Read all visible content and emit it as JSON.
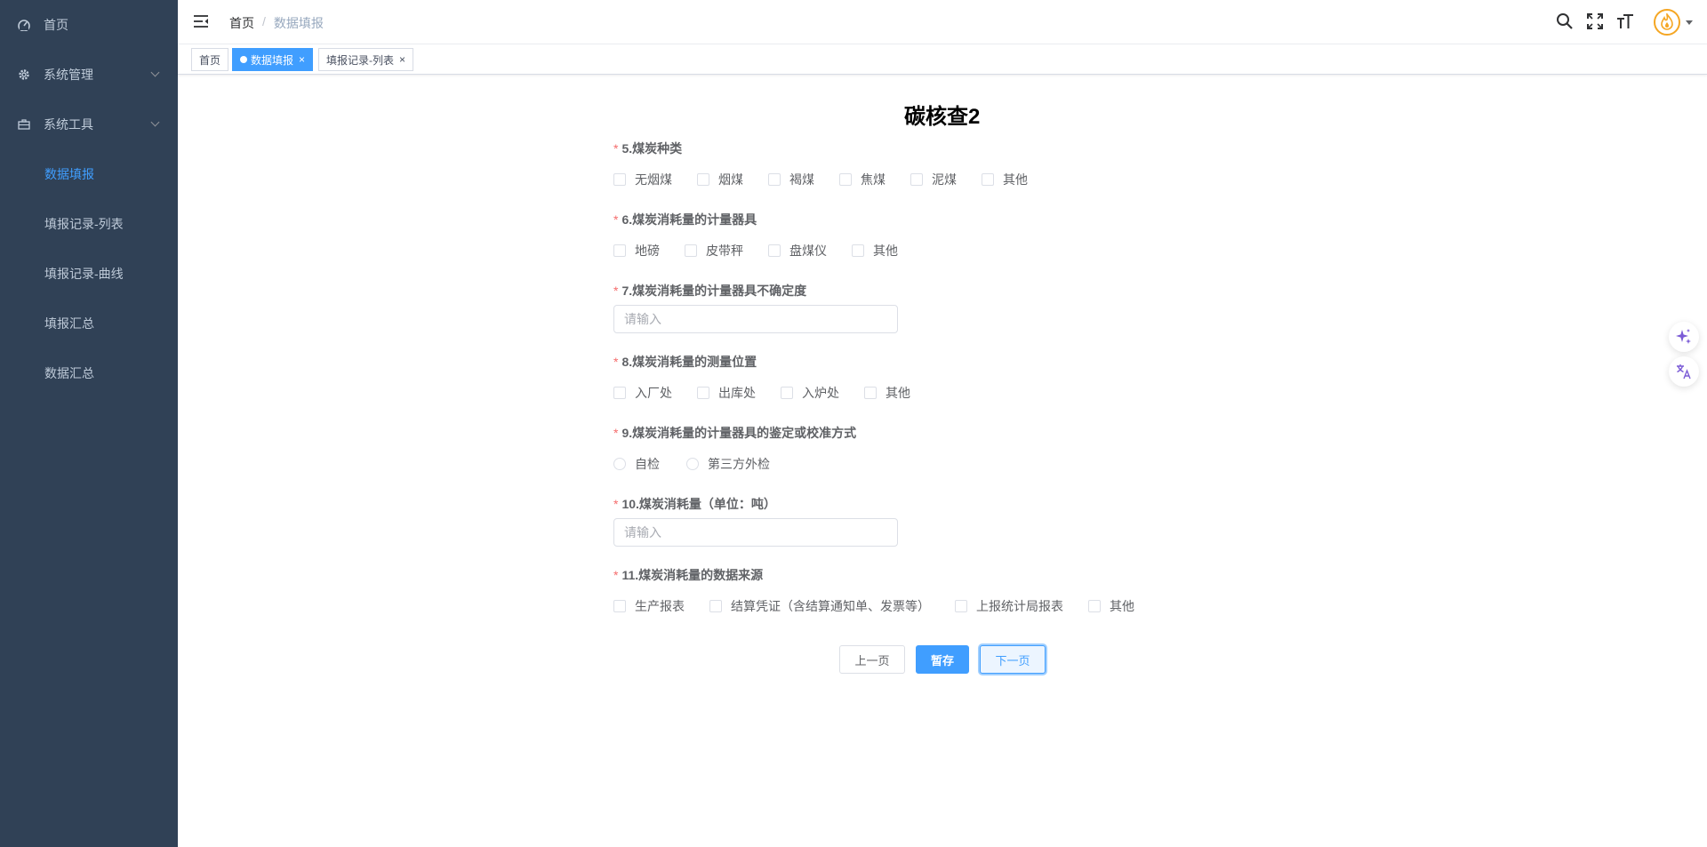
{
  "sidebar": {
    "items": [
      {
        "label": "首页",
        "icon": "dashboard-icon"
      },
      {
        "label": "系统管理",
        "icon": "gear-icon"
      },
      {
        "label": "系统工具",
        "icon": "toolbox-icon"
      },
      {
        "label": "数据填报"
      },
      {
        "label": "填报记录-列表"
      },
      {
        "label": "填报记录-曲线"
      },
      {
        "label": "填报汇总"
      },
      {
        "label": "数据汇总"
      }
    ],
    "active": "数据填报",
    "bg": "#304156",
    "active_color": "#409eff"
  },
  "navbar": {
    "breadcrumb": {
      "home": "首页",
      "sep": "/",
      "current": "数据填报"
    },
    "icons": [
      "search-icon",
      "fullscreen-icon",
      "font-size-icon"
    ],
    "avatar": "flame-logo-icon"
  },
  "tags": [
    {
      "label": "首页",
      "active": false
    },
    {
      "label": "数据填报",
      "active": true
    },
    {
      "label": "填报记录-列表",
      "active": false
    }
  ],
  "form": {
    "title": "碳核查2",
    "q5": {
      "label": "5.煤炭种类",
      "options": [
        "无烟煤",
        "烟煤",
        "褐煤",
        "焦煤",
        "泥煤",
        "其他"
      ]
    },
    "q6": {
      "label": "6.煤炭消耗量的计量器具",
      "options": [
        "地磅",
        "皮带秤",
        "盘煤仪",
        "其他"
      ]
    },
    "q7": {
      "label": "7.煤炭消耗量的计量器具不确定度",
      "placeholder": "请输入"
    },
    "q8": {
      "label": "8.煤炭消耗量的测量位置",
      "options": [
        "入厂处",
        "出库处",
        "入炉处",
        "其他"
      ]
    },
    "q9": {
      "label": "9.煤炭消耗量的计量器具的鉴定或校准方式",
      "options": [
        "自检",
        "第三方外检"
      ]
    },
    "q10": {
      "label": "10.煤炭消耗量（单位：吨）",
      "placeholder": "请输入"
    },
    "q11": {
      "label": "11.煤炭消耗量的数据来源",
      "options": [
        "生产报表",
        "结算凭证（含结算通知单、发票等）",
        "上报统计局报表",
        "其他"
      ]
    },
    "required_mark": "*"
  },
  "buttons": {
    "prev": "上一页",
    "save": "暂存",
    "next": "下一页"
  },
  "float_tools": [
    "sparkle-icon",
    "translate-icon"
  ]
}
